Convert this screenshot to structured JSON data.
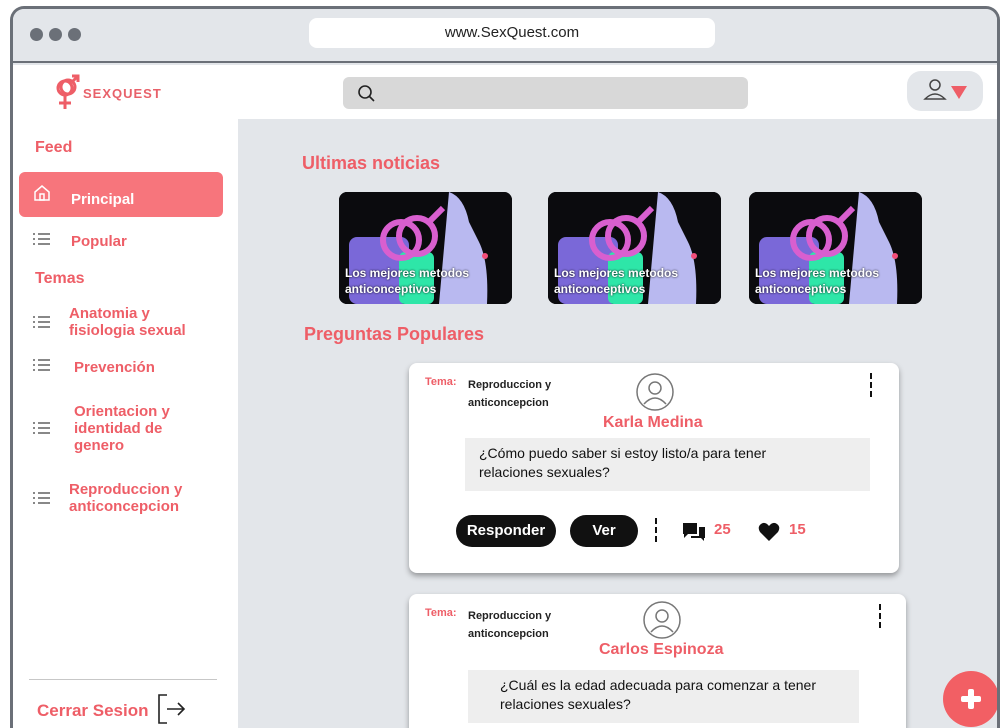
{
  "browser": {
    "url": "www.SexQuest.com"
  },
  "app": {
    "logo_text": "SEXQUEST"
  },
  "search": {
    "placeholder": ""
  },
  "sidebar": {
    "feed_title": "Feed",
    "feed_items": [
      {
        "label": "Principal",
        "icon": "home-icon",
        "active": true
      },
      {
        "label": "Popular",
        "icon": "list-icon",
        "active": false
      }
    ],
    "topics_title": "Temas",
    "topics": [
      {
        "label": "Anatomia y fisiologia sexual",
        "icon": "list-icon"
      },
      {
        "label": "Prevención",
        "icon": "list-icon"
      },
      {
        "label": "Orientacion y identidad de genero",
        "icon": "list-icon"
      },
      {
        "label": "Reproduccion y anticoncepcion",
        "icon": "list-icon"
      }
    ],
    "logout_label": "Cerrar Sesion"
  },
  "main": {
    "news_title": "Ultimas noticias",
    "news": [
      {
        "title": "Los mejores metodos anticonceptivos"
      },
      {
        "title": "Los mejores metodos anticonceptivos"
      },
      {
        "title": "Los mejores metodos anticonceptivos"
      }
    ],
    "popular_title": "Preguntas Populares",
    "questions": [
      {
        "tema_label": "Tema:",
        "tema_value": "Reproduccion y anticoncepcion",
        "author": "Karla Medina",
        "question": "¿Cómo puedo saber si estoy listo/a para tener relaciones sexuales?",
        "reply_label": "Responder",
        "view_label": "Ver",
        "comments": "25",
        "likes": "15"
      },
      {
        "tema_label": "Tema:",
        "tema_value": "Reproduccion y anticoncepcion",
        "author": "Carlos Espinoza",
        "question": "¿Cuál es la edad adecuada para comenzar a tener relaciones sexuales?"
      }
    ]
  },
  "colors": {
    "accent": "#ee5e67",
    "active_bg": "#f7757c",
    "frame": "#6b7078",
    "content_bg": "#e3e6ea"
  }
}
